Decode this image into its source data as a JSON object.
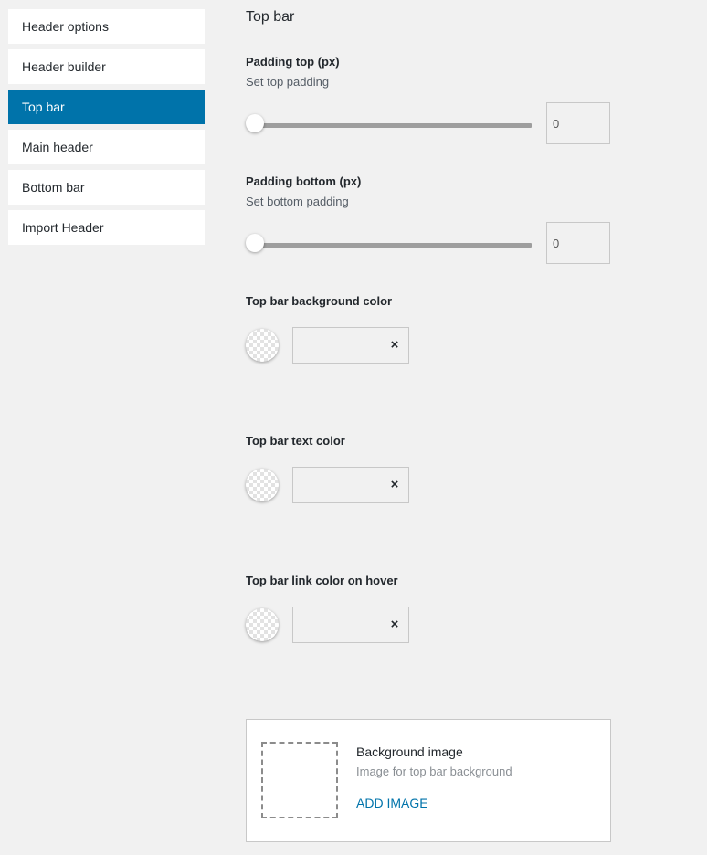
{
  "sidebar": {
    "items": [
      {
        "label": "Header options",
        "active": false
      },
      {
        "label": "Header builder",
        "active": false
      },
      {
        "label": "Top bar",
        "active": true
      },
      {
        "label": "Main header",
        "active": false
      },
      {
        "label": "Bottom bar",
        "active": false
      },
      {
        "label": "Import Header",
        "active": false
      }
    ],
    "active_color": "#0073aa"
  },
  "main": {
    "title": "Top bar",
    "padding_top": {
      "label": "Padding top (px)",
      "description": "Set top padding",
      "value": "0",
      "slider_value": 0
    },
    "padding_bottom": {
      "label": "Padding bottom (px)",
      "description": "Set bottom padding",
      "value": "0",
      "slider_value": 0
    },
    "bg_color": {
      "label": "Top bar background color",
      "value": "",
      "clear_icon": "×"
    },
    "text_color": {
      "label": "Top bar text color",
      "value": "",
      "clear_icon": "×"
    },
    "link_hover_color": {
      "label": "Top bar link color on hover",
      "value": "",
      "clear_icon": "×"
    },
    "background_image": {
      "title": "Background image",
      "description": "Image for top bar background",
      "add_label": "ADD IMAGE"
    }
  },
  "icons": {
    "clear": "close-icon",
    "placeholder": "image-placeholder-icon",
    "swatch": "transparent-swatch-icon"
  },
  "colors": {
    "accent": "#0073aa",
    "background": "#f1f1f1",
    "slider_track": "#9e9e9e"
  }
}
